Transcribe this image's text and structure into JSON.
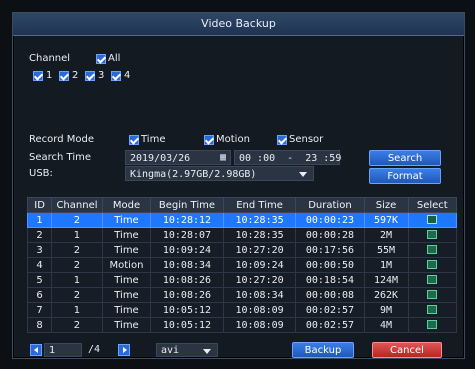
{
  "window": {
    "title": "Video Backup"
  },
  "channel": {
    "label": "Channel",
    "all_label": "All",
    "items": [
      {
        "label": "1"
      },
      {
        "label": "2"
      },
      {
        "label": "3"
      },
      {
        "label": "4"
      }
    ]
  },
  "filters": {
    "record_mode_label": "Record Mode",
    "modes": [
      {
        "label": "Time"
      },
      {
        "label": "Motion"
      },
      {
        "label": "Sensor"
      }
    ],
    "search_time_label": "Search Time",
    "date_value": "2019/03/26",
    "time_from": "00 :00",
    "time_sep": "-",
    "time_to": "23 :59",
    "usb_label": "USB:",
    "usb_value": "Kingma(2.97GB/2.98GB)"
  },
  "buttons": {
    "search": "Search",
    "format": "Format",
    "backup": "Backup",
    "cancel": "Cancel"
  },
  "table": {
    "headers": [
      "ID",
      "Channel",
      "Mode",
      "Begin Time",
      "End Time",
      "Duration",
      "Size",
      "Select"
    ],
    "rows": [
      {
        "id": "1",
        "channel": "2",
        "mode": "Time",
        "begin": "10:28:12",
        "end": "10:28:35",
        "duration": "00:00:23",
        "size": "597K"
      },
      {
        "id": "2",
        "channel": "1",
        "mode": "Time",
        "begin": "10:28:07",
        "end": "10:28:35",
        "duration": "00:00:28",
        "size": "2M"
      },
      {
        "id": "3",
        "channel": "2",
        "mode": "Time",
        "begin": "10:09:24",
        "end": "10:27:20",
        "duration": "00:17:56",
        "size": "55M"
      },
      {
        "id": "4",
        "channel": "2",
        "mode": "Motion",
        "begin": "10:08:34",
        "end": "10:09:24",
        "duration": "00:00:50",
        "size": "1M"
      },
      {
        "id": "5",
        "channel": "1",
        "mode": "Time",
        "begin": "10:08:26",
        "end": "10:27:20",
        "duration": "00:18:54",
        "size": "124M"
      },
      {
        "id": "6",
        "channel": "2",
        "mode": "Time",
        "begin": "10:08:26",
        "end": "10:08:34",
        "duration": "00:00:08",
        "size": "262K"
      },
      {
        "id": "7",
        "channel": "1",
        "mode": "Time",
        "begin": "10:05:12",
        "end": "10:08:09",
        "duration": "00:02:57",
        "size": "9M"
      },
      {
        "id": "8",
        "channel": "2",
        "mode": "Time",
        "begin": "10:05:12",
        "end": "10:08:09",
        "duration": "00:02:57",
        "size": "4M"
      }
    ]
  },
  "pager": {
    "page": "1",
    "total": "/4"
  },
  "format_select": {
    "value": "avi"
  },
  "colors": {
    "accent_blue": "#2b6bd8",
    "title_bar": "#2f4766",
    "selected_row": "#1e78ff",
    "cancel_red": "#e05656"
  },
  "icons": {
    "calendar": "calendar-icon",
    "prev": "chevron-left-icon",
    "next": "chevron-right-icon"
  }
}
